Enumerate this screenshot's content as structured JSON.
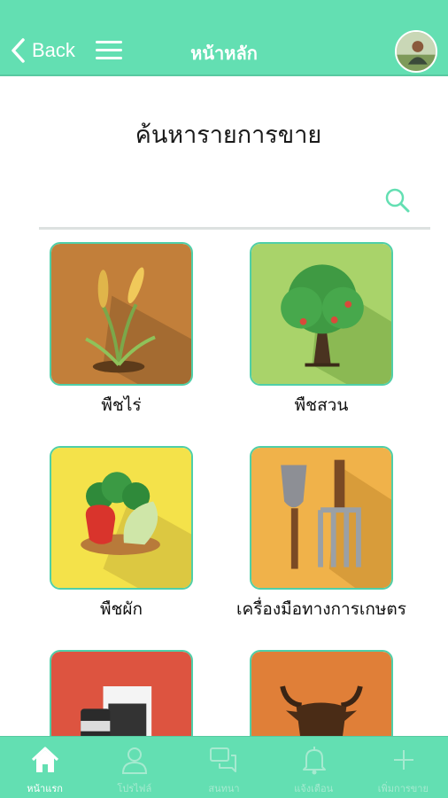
{
  "header": {
    "back_label": "Back",
    "title": "หน้าหลัก"
  },
  "search": {
    "title": "ค้นหารายการขาย",
    "placeholder": ""
  },
  "categories": [
    {
      "label": "พืชไร่"
    },
    {
      "label": "พืชสวน"
    },
    {
      "label": "พืชผัก"
    },
    {
      "label": "เครื่องมือทางการเกษตร"
    },
    {
      "label": ""
    },
    {
      "label": ""
    }
  ],
  "tabs": [
    {
      "label": "หน้าแรก",
      "icon": "home-icon",
      "active": true
    },
    {
      "label": "โปรไฟล์",
      "icon": "profile-icon",
      "active": false
    },
    {
      "label": "สนทนา",
      "icon": "chat-icon",
      "active": false
    },
    {
      "label": "แจ้งเตือน",
      "icon": "bell-icon",
      "active": false
    },
    {
      "label": "เพิ่มการขาย",
      "icon": "plus-icon",
      "active": false
    }
  ],
  "colors": {
    "header_bg": "#63dfb2",
    "tabbar_bg": "#63dfb2",
    "tab_active": "#ffffff",
    "tab_inactive": "#a6ead0",
    "tile_border": "#4fcfa8"
  }
}
